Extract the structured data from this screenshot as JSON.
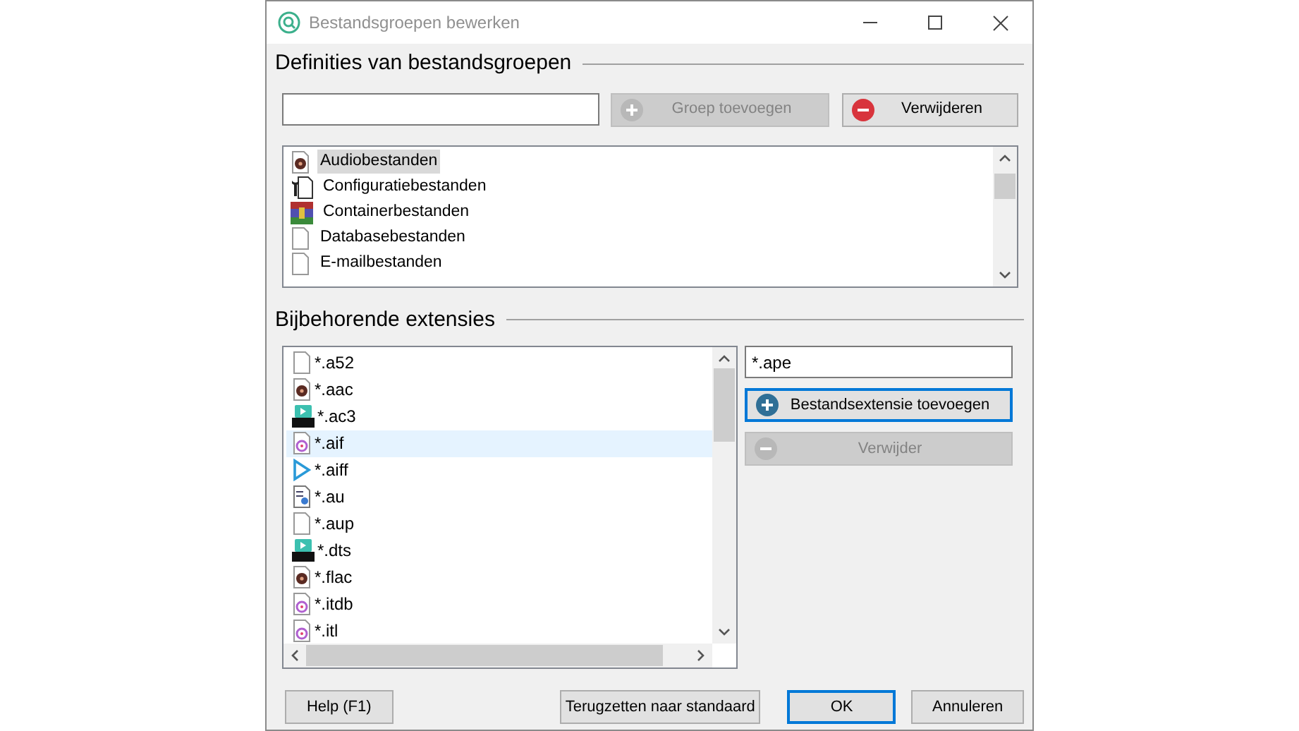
{
  "window": {
    "title": "Bestandsgroepen bewerken"
  },
  "groups_section": {
    "heading": "Definities van bestandsgroepen",
    "buttons": [
      {
        "label": "Groep toevoegen",
        "kind": "add",
        "disabled": true
      },
      {
        "label": "Verwijderen",
        "kind": "remove",
        "disabled": false
      }
    ],
    "items": [
      {
        "label": "Audiobestanden",
        "kind": "audio",
        "selected": true
      },
      {
        "label": "Configuratiebestanden",
        "kind": "config",
        "selected": false
      },
      {
        "label": "Containerbestanden",
        "kind": "archive",
        "selected": false
      },
      {
        "label": "Databasebestanden",
        "kind": "blank",
        "selected": false
      },
      {
        "label": "E-mailbestanden",
        "kind": "blank",
        "selected": false
      }
    ]
  },
  "extensions_section": {
    "heading": "Bijbehorende extensies",
    "items": [
      {
        "label": "*.a52",
        "kind": "blank",
        "selected": false
      },
      {
        "label": "*.aac",
        "kind": "audio",
        "selected": false
      },
      {
        "label": "*.ac3",
        "kind": "ac3",
        "selected": false
      },
      {
        "label": "*.aif",
        "kind": "music",
        "selected": true
      },
      {
        "label": "*.aiff",
        "kind": "play",
        "selected": false
      },
      {
        "label": "*.au",
        "kind": "au",
        "selected": false
      },
      {
        "label": "*.aup",
        "kind": "blank",
        "selected": false
      },
      {
        "label": "*.dts",
        "kind": "dts",
        "selected": false
      },
      {
        "label": "*.flac",
        "kind": "audio",
        "selected": false
      },
      {
        "label": "*.itdb",
        "kind": "music",
        "selected": false
      },
      {
        "label": "*.itl",
        "kind": "music",
        "selected": false
      }
    ],
    "extension_field": {
      "value": "*.ape"
    },
    "buttons": [
      {
        "label": "Bestandsextensie toevoegen",
        "kind": "add",
        "disabled": false,
        "default": true
      },
      {
        "label": "Verwijder",
        "kind": "remove",
        "disabled": true,
        "default": false
      }
    ]
  },
  "footer_buttons": [
    {
      "label": "Help (F1)",
      "default": false
    },
    {
      "label": "Terugzetten naar standaard",
      "default": false
    },
    {
      "label": "OK",
      "default": true
    },
    {
      "label": "Annuleren",
      "default": false
    }
  ]
}
